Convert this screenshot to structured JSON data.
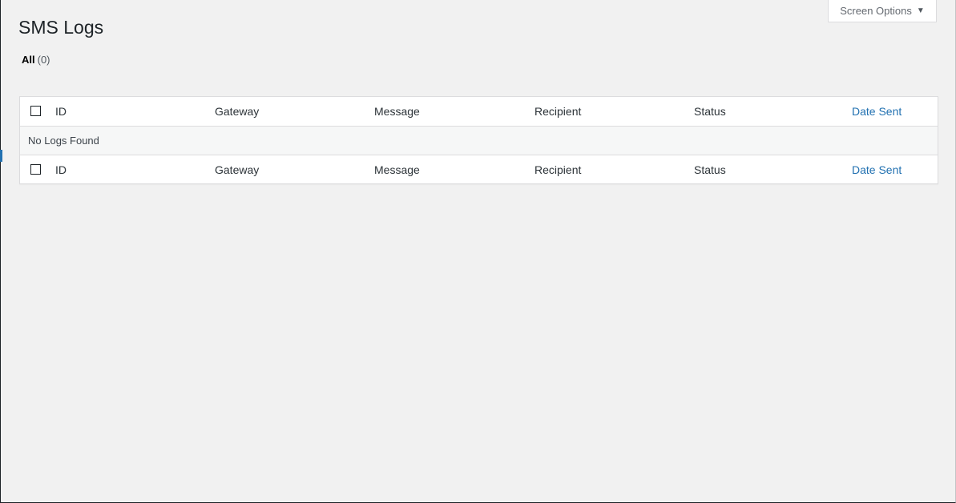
{
  "screen_options": {
    "label": "Screen Options",
    "caret_icon": "caret-down-icon"
  },
  "page": {
    "title": "SMS Logs"
  },
  "filters": {
    "all_label": "All",
    "all_count": "(0)"
  },
  "table": {
    "columns": {
      "id": "ID",
      "gateway": "Gateway",
      "message": "Message",
      "recipient": "Recipient",
      "status": "Status",
      "date_sent": "Date Sent"
    },
    "empty_message": "No Logs Found"
  },
  "colors": {
    "background": "#f1f1f1",
    "link": "#2271b1",
    "text": "#23282d"
  }
}
